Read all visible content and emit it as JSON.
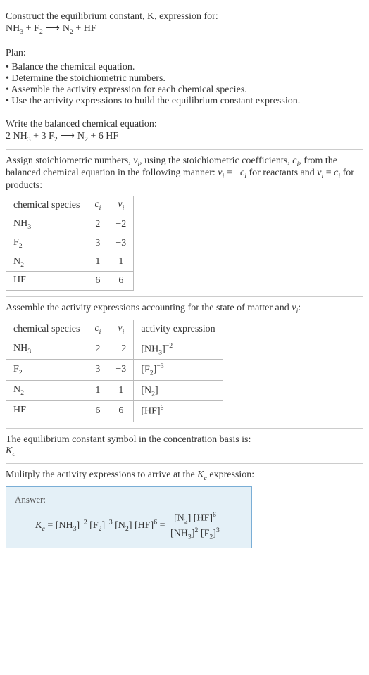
{
  "header": {
    "prompt_line1": "Construct the equilibrium constant, K, expression for:",
    "unbalanced_lhs1": "NH",
    "unbalanced_lhs1_sub": "3",
    "plus1": " + ",
    "unbalanced_lhs2": "F",
    "unbalanced_lhs2_sub": "2",
    "arrow": " ⟶ ",
    "unbalanced_rhs1": "N",
    "unbalanced_rhs1_sub": "2",
    "plus2": " + ",
    "unbalanced_rhs2": "HF"
  },
  "plan": {
    "title": "Plan:",
    "items": [
      "Balance the chemical equation.",
      "Determine the stoichiometric numbers.",
      "Assemble the activity expression for each chemical species.",
      "Use the activity expressions to build the equilibrium constant expression."
    ]
  },
  "balanced": {
    "title": "Write the balanced chemical equation:",
    "c1": "2 ",
    "s1": "NH",
    "s1sub": "3",
    "plus1": " + ",
    "c2": "3 ",
    "s2": "F",
    "s2sub": "2",
    "arrow": " ⟶ ",
    "s3": "N",
    "s3sub": "2",
    "plus2": " + ",
    "c4": "6 ",
    "s4": "HF"
  },
  "stoich": {
    "intro_a": "Assign stoichiometric numbers, ",
    "nu": "ν",
    "nusub": "i",
    "intro_b": ", using the stoichiometric coefficients, ",
    "c": "c",
    "csub": "i",
    "intro_c": ", from the balanced chemical equation in the following manner: ",
    "rel1a": "ν",
    "rel1asub": "i",
    "rel1eq": " = −",
    "rel1b": "c",
    "rel1bsub": "i",
    "intro_d": " for reactants and ",
    "rel2a": "ν",
    "rel2asub": "i",
    "rel2eq": " = ",
    "rel2b": "c",
    "rel2bsub": "i",
    "intro_e": " for products:"
  },
  "table1": {
    "h1": "chemical species",
    "h2": "c",
    "h2sub": "i",
    "h3": "ν",
    "h3sub": "i",
    "rows": [
      {
        "sp": "NH",
        "sub": "3",
        "c": "2",
        "nu": "−2"
      },
      {
        "sp": "F",
        "sub": "2",
        "c": "3",
        "nu": "−3"
      },
      {
        "sp": "N",
        "sub": "2",
        "c": "1",
        "nu": "1"
      },
      {
        "sp": "HF",
        "sub": "",
        "c": "6",
        "nu": "6"
      }
    ]
  },
  "activity_intro_a": "Assemble the activity expressions accounting for the state of matter and ",
  "activity_intro_nu": "ν",
  "activity_intro_nusub": "i",
  "activity_intro_b": ":",
  "table2": {
    "h1": "chemical species",
    "h2": "c",
    "h2sub": "i",
    "h3": "ν",
    "h3sub": "i",
    "h4": "activity expression",
    "rows": [
      {
        "sp": "NH",
        "sub": "3",
        "c": "2",
        "nu": "−2",
        "act_base": "[NH",
        "act_sub": "3",
        "act_close": "]",
        "act_sup": "−2"
      },
      {
        "sp": "F",
        "sub": "2",
        "c": "3",
        "nu": "−3",
        "act_base": "[F",
        "act_sub": "2",
        "act_close": "]",
        "act_sup": "−3"
      },
      {
        "sp": "N",
        "sub": "2",
        "c": "1",
        "nu": "1",
        "act_base": "[N",
        "act_sub": "2",
        "act_close": "]",
        "act_sup": ""
      },
      {
        "sp": "HF",
        "sub": "",
        "c": "6",
        "nu": "6",
        "act_base": "[HF",
        "act_sub": "",
        "act_close": "]",
        "act_sup": "6"
      }
    ]
  },
  "kc_symbol": {
    "line1": "The equilibrium constant symbol in the concentration basis is:",
    "sym": "K",
    "symsub": "c"
  },
  "multiply": {
    "line_a": "Mulitply the activity expressions to arrive at the ",
    "k": "K",
    "ksub": "c",
    "line_b": " expression:"
  },
  "answer": {
    "label": "Answer:",
    "k": "K",
    "ksub": "c",
    "eq": " = ",
    "t1": "[NH",
    "t1sub": "3",
    "t1close": "]",
    "t1sup": "−2",
    "sp": " ",
    "t2": "[F",
    "t2sub": "2",
    "t2close": "]",
    "t2sup": "−3",
    "t3": "[N",
    "t3sub": "2",
    "t3close": "]",
    "t4": "[HF]",
    "t4sup": "6",
    "eq2": " = ",
    "num1": "[N",
    "num1sub": "2",
    "num1close": "] ",
    "num2": "[HF]",
    "num2sup": "6",
    "den1": "[NH",
    "den1sub": "3",
    "den1close": "]",
    "den1sup": "2",
    "den2": "[F",
    "den2sub": "2",
    "den2close": "]",
    "den2sup": "3"
  }
}
